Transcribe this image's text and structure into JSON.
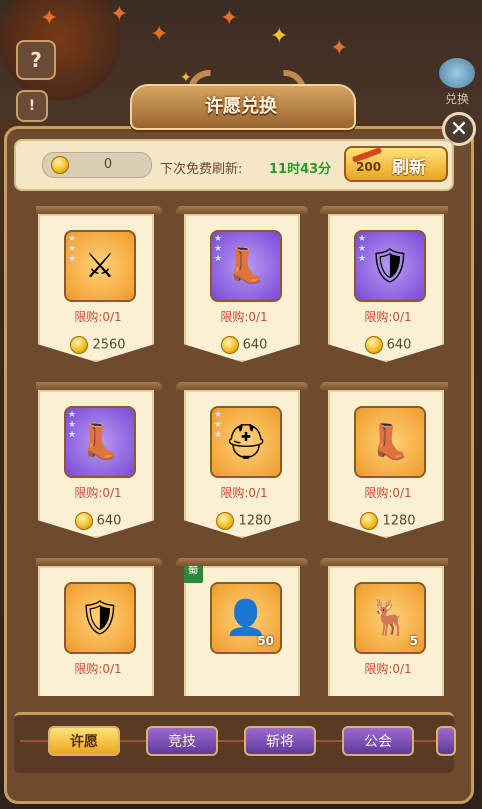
{
  "header": {
    "title": "许愿兑换",
    "top_right_label": "兑换",
    "help_icon": "question-icon",
    "alert_icon": "exclamation-icon",
    "close_icon": "close-icon"
  },
  "topbar": {
    "balance": "0",
    "refresh_label": "下次免费刷新:",
    "refresh_time": "11时43分",
    "refresh_cost": "200",
    "refresh_button_label": "刷新"
  },
  "items": [
    {
      "name": "weapon-icon",
      "bg": "orange",
      "stars": true,
      "limit": "限购:0/1",
      "price": "2560",
      "glyph": "⚔"
    },
    {
      "name": "boots-icon",
      "bg": "purple",
      "stars": true,
      "limit": "限购:0/1",
      "price": "640",
      "glyph": "👢"
    },
    {
      "name": "armor-icon",
      "bg": "purple",
      "stars": true,
      "limit": "限购:0/1",
      "price": "640",
      "glyph": "🛡"
    },
    {
      "name": "boots-icon",
      "bg": "purple",
      "stars": true,
      "limit": "限购:0/1",
      "price": "640",
      "glyph": "👢"
    },
    {
      "name": "helmet-icon",
      "bg": "orange",
      "stars": true,
      "limit": "限购:0/1",
      "price": "1280",
      "glyph": "⛑"
    },
    {
      "name": "boots-icon",
      "bg": "orange",
      "stars": false,
      "limit": "限购:0/1",
      "price": "1280",
      "glyph": "👢"
    },
    {
      "name": "armor-icon",
      "bg": "orange",
      "stars": false,
      "limit": "限购:0/1",
      "price": "",
      "glyph": "🛡"
    },
    {
      "name": "hero-portrait-icon",
      "bg": "orange",
      "stars": false,
      "limit": "",
      "price": "",
      "glyph": "👤",
      "badge": "蜀",
      "level": "50"
    },
    {
      "name": "deer-mount-icon",
      "bg": "orange",
      "stars": false,
      "limit": "限购:0/1",
      "price": "",
      "glyph": "🦌",
      "level": "5"
    }
  ],
  "tabs": [
    {
      "label": "许愿",
      "active": true
    },
    {
      "label": "竞技",
      "active": false
    },
    {
      "label": "斩将",
      "active": false
    },
    {
      "label": "公会",
      "active": false
    }
  ]
}
